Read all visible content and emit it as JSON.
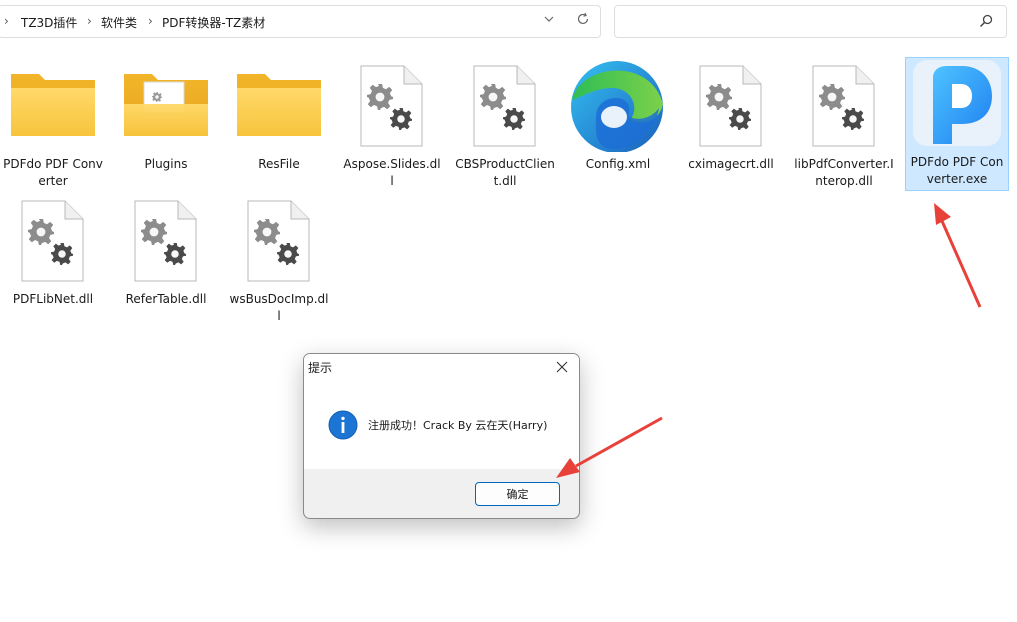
{
  "breadcrumb": {
    "items": [
      "TZ3D插件",
      "软件类",
      "PDF转换器-TZ素材"
    ]
  },
  "address_bar": {
    "dropdown_icon": "chevron-down-icon",
    "refresh_icon": "refresh-icon"
  },
  "search": {
    "placeholder": "",
    "icon": "search-icon"
  },
  "files": [
    {
      "name": "PDFdo PDF Converter",
      "icon": "folder-icon",
      "selected": false
    },
    {
      "name": "Plugins",
      "icon": "folder-with-file-icon",
      "selected": false
    },
    {
      "name": "ResFile",
      "icon": "folder-icon",
      "selected": false
    },
    {
      "name": "Aspose.Slides.dll",
      "icon": "dll-gear-file-icon",
      "selected": false
    },
    {
      "name": "CBSProductClient.dll",
      "icon": "dll-gear-file-icon",
      "selected": false
    },
    {
      "name": "Config.xml",
      "icon": "edge-browser-icon",
      "selected": false
    },
    {
      "name": "cximagecrt.dll",
      "icon": "dll-gear-file-icon",
      "selected": false
    },
    {
      "name": "libPdfConverter.Interop.dll",
      "icon": "dll-gear-file-icon",
      "selected": false
    },
    {
      "name": "PDFdo PDF Converter.exe",
      "icon": "pdfdo-app-icon",
      "selected": true
    },
    {
      "name": "PDFLibNet.dll",
      "icon": "dll-gear-file-icon",
      "selected": false
    },
    {
      "name": "ReferTable.dll",
      "icon": "dll-gear-file-icon",
      "selected": false
    },
    {
      "name": "wsBusDocImp.dll",
      "icon": "dll-gear-file-icon",
      "selected": false
    }
  ],
  "dialog": {
    "title": "提示",
    "message": "注册成功！Crack By 云在天(Harry)",
    "ok_label": "确定",
    "icon": "info-icon"
  },
  "colors": {
    "selection": "#cde8ff",
    "selection_border": "#99d1ff",
    "folder": "#f7c948",
    "accent": "#0067c0",
    "annotation_arrow": "#e8413a"
  }
}
